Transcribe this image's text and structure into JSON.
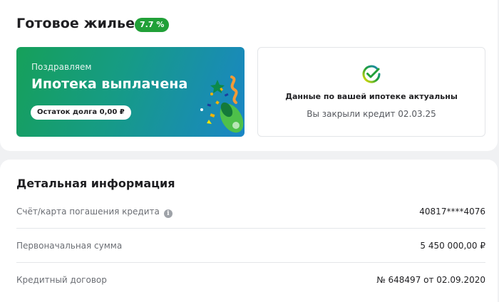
{
  "header": {
    "title": "Готовое жилье",
    "rate_badge": "7.7 %"
  },
  "promo": {
    "congrats": "Поздравляем",
    "title": "Ипотека выплачена",
    "balance": "Остаток долга 0,00 ₽"
  },
  "status": {
    "icon": "sber-check-icon",
    "title": "Данные по вашей ипотеке актуальны",
    "subtitle": "Вы закрыли кредит 02.03.25"
  },
  "details": {
    "title": "Детальная информация",
    "rows": [
      {
        "label": "Счёт/карта погашения кредита",
        "value": "40817****4076",
        "has_info": true
      },
      {
        "label": "Первоначальная сумма",
        "value": "5 450 000,00 ₽"
      },
      {
        "label": "Кредитный договор",
        "value": "№ 648497 от 02.09.2020"
      }
    ]
  },
  "colors": {
    "brand_green": "#21a038",
    "banner_gradient_start": "#16a05a",
    "banner_gradient_end": "#1a86c6"
  }
}
